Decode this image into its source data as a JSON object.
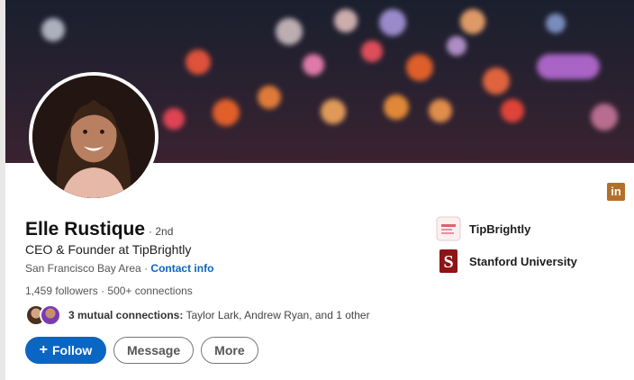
{
  "profile": {
    "name": "Elle Rustique",
    "degree": "· 2nd",
    "headline": "CEO & Founder at TipBrightly",
    "location": "San Francisco Bay Area ·",
    "contact_label": "Contact info",
    "followers": "1,459 followers",
    "connections": "· 500+ connections",
    "mutual_bold": "3 mutual connections:",
    "mutual_rest": "Taylor Lark, Andrew Ryan, and 1 other"
  },
  "buttons": {
    "follow": "Follow",
    "message": "Message",
    "more": "More"
  },
  "sidebar": {
    "company": "TipBrightly",
    "school": "Stanford University"
  },
  "icons": {
    "linkedin": "in",
    "plus": "+",
    "stanford": "S"
  },
  "colors": {
    "accent": "#0a66c2",
    "linkedin_badge": "#b3702a",
    "stanford": "#8c1515"
  }
}
